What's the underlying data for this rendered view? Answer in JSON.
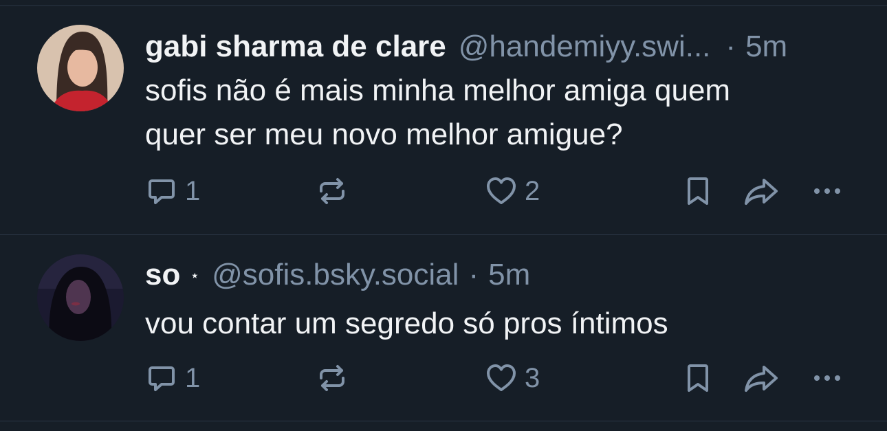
{
  "posts": [
    {
      "display_name": "gabi sharma de clare",
      "handle": "@handemiyy.swi...",
      "separator": "·",
      "time": "5m",
      "text_line1": "sofis não é mais minha melhor amiga quem",
      "text_line2": "quer ser meu novo melhor amigue?",
      "reply_count": "1",
      "like_count": "2",
      "avatar_colors": {
        "bg": "#d9c3b0",
        "hair": "#3a2a24",
        "top": "#c4232e"
      }
    },
    {
      "display_name": "so",
      "badge": "⋆",
      "handle": "@sofis.bsky.social",
      "separator": "·",
      "time": "5m",
      "text_line1": "vou contar um segredo só pros íntimos",
      "reply_count": "1",
      "like_count": "3",
      "avatar_colors": {
        "bg": "#1a1830",
        "hair": "#0c0b14",
        "face": "#5b3a55"
      }
    }
  ],
  "icons": {
    "reply": "reply-icon",
    "repost": "repost-icon",
    "like": "heart-icon",
    "save": "bookmark-icon",
    "share": "share-icon",
    "more": "more-icon"
  },
  "colors": {
    "background": "#161e27",
    "divider": "#2a3645",
    "muted": "#8193a8",
    "text": "#f1f3f5"
  }
}
